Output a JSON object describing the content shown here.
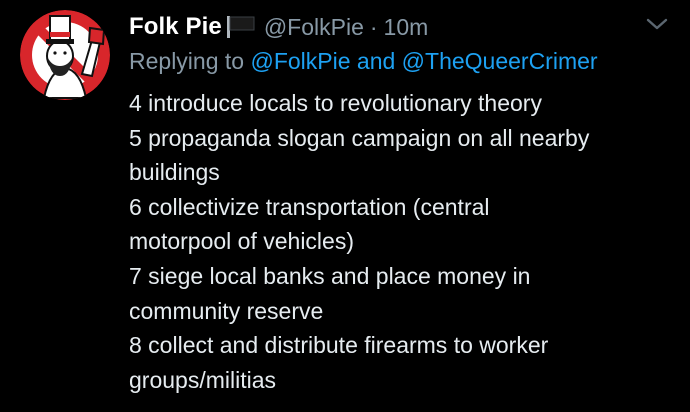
{
  "author": {
    "display_name": "Folk Pie",
    "handle": "@FolkPie",
    "separator": "·",
    "timestamp": "10m",
    "avatar_icon": "top-hat-revolutionary-avatar",
    "badge_icon": "black-flag-icon"
  },
  "reply": {
    "prefix": "Replying to",
    "mention_1": "@FolkPie",
    "conjunction": "and",
    "mention_2": "@TheQueerCrimer"
  },
  "body_lines": [
    "4 introduce locals to revolutionary theory",
    "5 propaganda slogan campaign on all nearby",
    "buildings",
    "6 collectivize transportation (central",
    "motorpool of vehicles)",
    "7 siege local banks and place money in",
    "community reserve",
    "8 collect and distribute firearms to worker",
    "groups/militias"
  ],
  "colors": {
    "background": "#000000",
    "name": "#ffffff",
    "muted": "#8899a6",
    "link": "#1da1f2",
    "avatar_ring": "#d8262b"
  }
}
